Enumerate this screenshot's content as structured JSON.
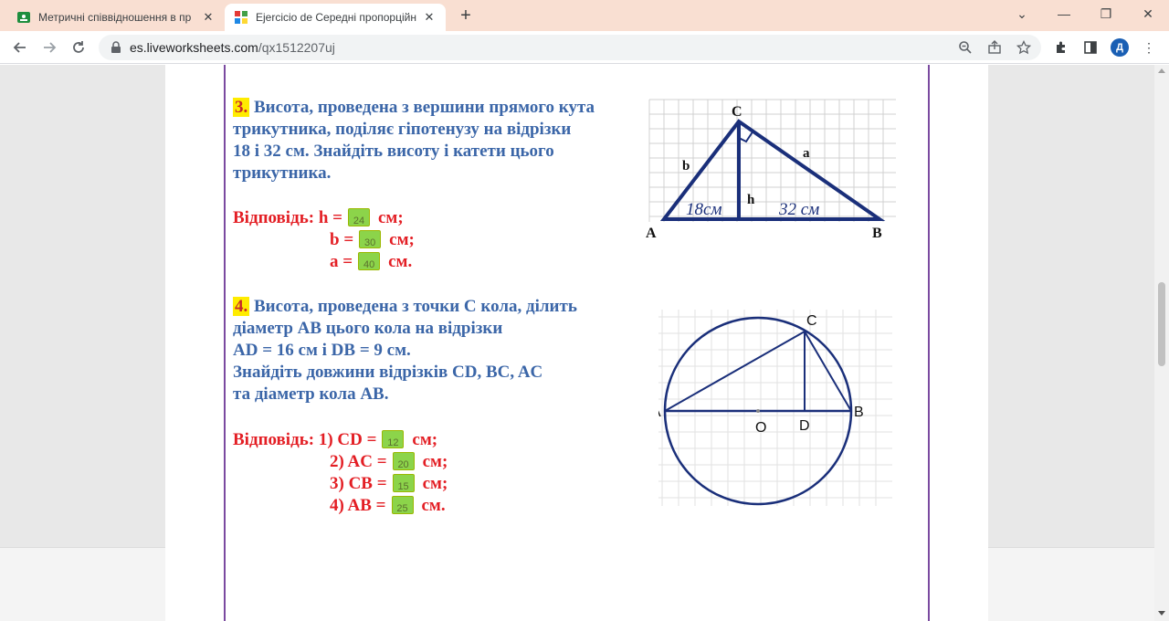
{
  "browser": {
    "tabs": [
      {
        "title": "Метричні співвідношення в пр",
        "favicon": "classroom-icon",
        "active": false
      },
      {
        "title": "Ejercicio de Середні пропорційн",
        "favicon": "liveworksheets-icon",
        "active": true
      }
    ],
    "url_host": "es.liveworksheets.com",
    "url_path": "/qx1512207uj",
    "profile_initial": "Д"
  },
  "worksheet": {
    "q3": {
      "number": "3.",
      "lines": [
        "Висота, проведена з вершини прямого кута",
        "трикутника, поділяє гіпотенузу на відрізки",
        "18 і 32 см. Знайдіть висоту і катети цього",
        "трикутника."
      ],
      "answer_label": "Відповідь:",
      "answers": [
        {
          "var": "h =",
          "value": "24",
          "unit": "см;"
        },
        {
          "var": "b =",
          "value": "30",
          "unit": "см;"
        },
        {
          "var": "a =",
          "value": "40",
          "unit": "см."
        }
      ],
      "diagram": {
        "vertices": [
          "A",
          "B",
          "C"
        ],
        "labels": {
          "b": "b",
          "a": "a",
          "h": "h",
          "seg1": "18см",
          "seg2": "32 см"
        }
      }
    },
    "q4": {
      "number": "4.",
      "lines": [
        "Висота, проведена з точки С кола, ділить",
        "діаметр АВ цього кола на відрізки",
        "AD = 16 см і DB = 9 см.",
        "Знайдіть довжини відрізків CD, BC, AC",
        "та діаметр кола АВ."
      ],
      "answer_label": "Відповідь:",
      "answers": [
        {
          "var": "1) CD =",
          "value": "12",
          "unit": "см;"
        },
        {
          "var": "2) AC =",
          "value": "20",
          "unit": "см;"
        },
        {
          "var": "3) CB =",
          "value": "15",
          "unit": "см;"
        },
        {
          "var": "4) AB =",
          "value": "25",
          "unit": "см."
        }
      ],
      "diagram": {
        "points": {
          "A": "A",
          "B": "B",
          "C": "C",
          "D": "D",
          "O": "O"
        }
      }
    }
  }
}
